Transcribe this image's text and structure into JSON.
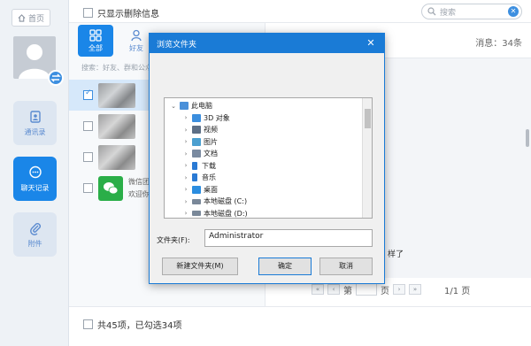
{
  "sidebar": {
    "home_label": "首页",
    "nav": [
      {
        "label": "通讯录"
      },
      {
        "label": "聊天记录"
      },
      {
        "label": "附件"
      }
    ]
  },
  "topbar": {
    "only_deleted_label": "只显示删除信息",
    "search_placeholder": "搜索"
  },
  "contacts": {
    "tabs": [
      {
        "label": "全部"
      },
      {
        "label": "好友"
      }
    ],
    "search_hint": "搜索：好友、群和公众",
    "items": [
      {
        "text": "",
        "checked": true
      },
      {
        "text": "",
        "checked": false
      },
      {
        "text": "",
        "checked": false
      },
      {
        "line1": "微信团",
        "line2": "欢迎你",
        "checked": false
      }
    ]
  },
  "chat": {
    "message_count": "消息：34条",
    "bubble_text": "样了"
  },
  "pager": {
    "prefix": "第",
    "suffix": "页",
    "total": "1/1 页"
  },
  "footer": {
    "summary": "共45项，已勾选34项"
  },
  "dialog": {
    "title": "浏览文件夹",
    "tree": [
      {
        "label": "此电脑",
        "expanded": true,
        "indent": 0,
        "icon": "pc",
        "color": "#4a90d9"
      },
      {
        "label": "3D 对象",
        "indent": 1,
        "icon": "folder",
        "color": "#3b8ede"
      },
      {
        "label": "视频",
        "indent": 1,
        "icon": "folder",
        "color": "#5d6f86"
      },
      {
        "label": "图片",
        "indent": 1,
        "icon": "folder",
        "color": "#4b9fd0"
      },
      {
        "label": "文档",
        "indent": 1,
        "icon": "folder",
        "color": "#7a8aa0"
      },
      {
        "label": "下载",
        "indent": 1,
        "icon": "download",
        "color": "#2a7ad4"
      },
      {
        "label": "音乐",
        "indent": 1,
        "icon": "music",
        "color": "#2a7ad4"
      },
      {
        "label": "桌面",
        "indent": 1,
        "icon": "folder",
        "color": "#2b8de0"
      },
      {
        "label": "本地磁盘 (C:)",
        "indent": 1,
        "icon": "drive",
        "color": "#7a8899"
      },
      {
        "label": "本地磁盘 (D:)",
        "indent": 1,
        "icon": "drive",
        "color": "#7a8899"
      }
    ],
    "folder_label": "文件夹(F):",
    "folder_value": "Administrator",
    "btn_new_folder": "新建文件夹(M)",
    "btn_ok": "确定",
    "btn_cancel": "取消"
  }
}
